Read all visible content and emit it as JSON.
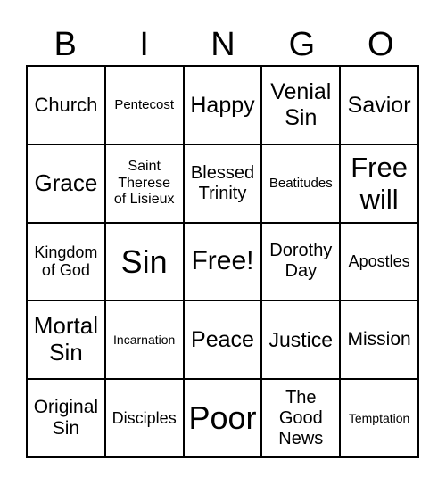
{
  "header": [
    "B",
    "I",
    "N",
    "G",
    "O"
  ],
  "cells": [
    "Church",
    "Pentecost",
    "Happy",
    "Venial Sin",
    "Savior",
    "Grace",
    "Saint Therese of Lisieux",
    "Blessed Trinity",
    "Beatitudes",
    "Free will",
    "Kingdom of God",
    "Sin",
    "Free!",
    "Dorothy Day",
    "Apostles",
    "Mortal Sin",
    "Incarnation",
    "Peace",
    "Justice",
    "Mission",
    "Original Sin",
    "Disciples",
    "Poor",
    "The Good News",
    "Temptation"
  ]
}
